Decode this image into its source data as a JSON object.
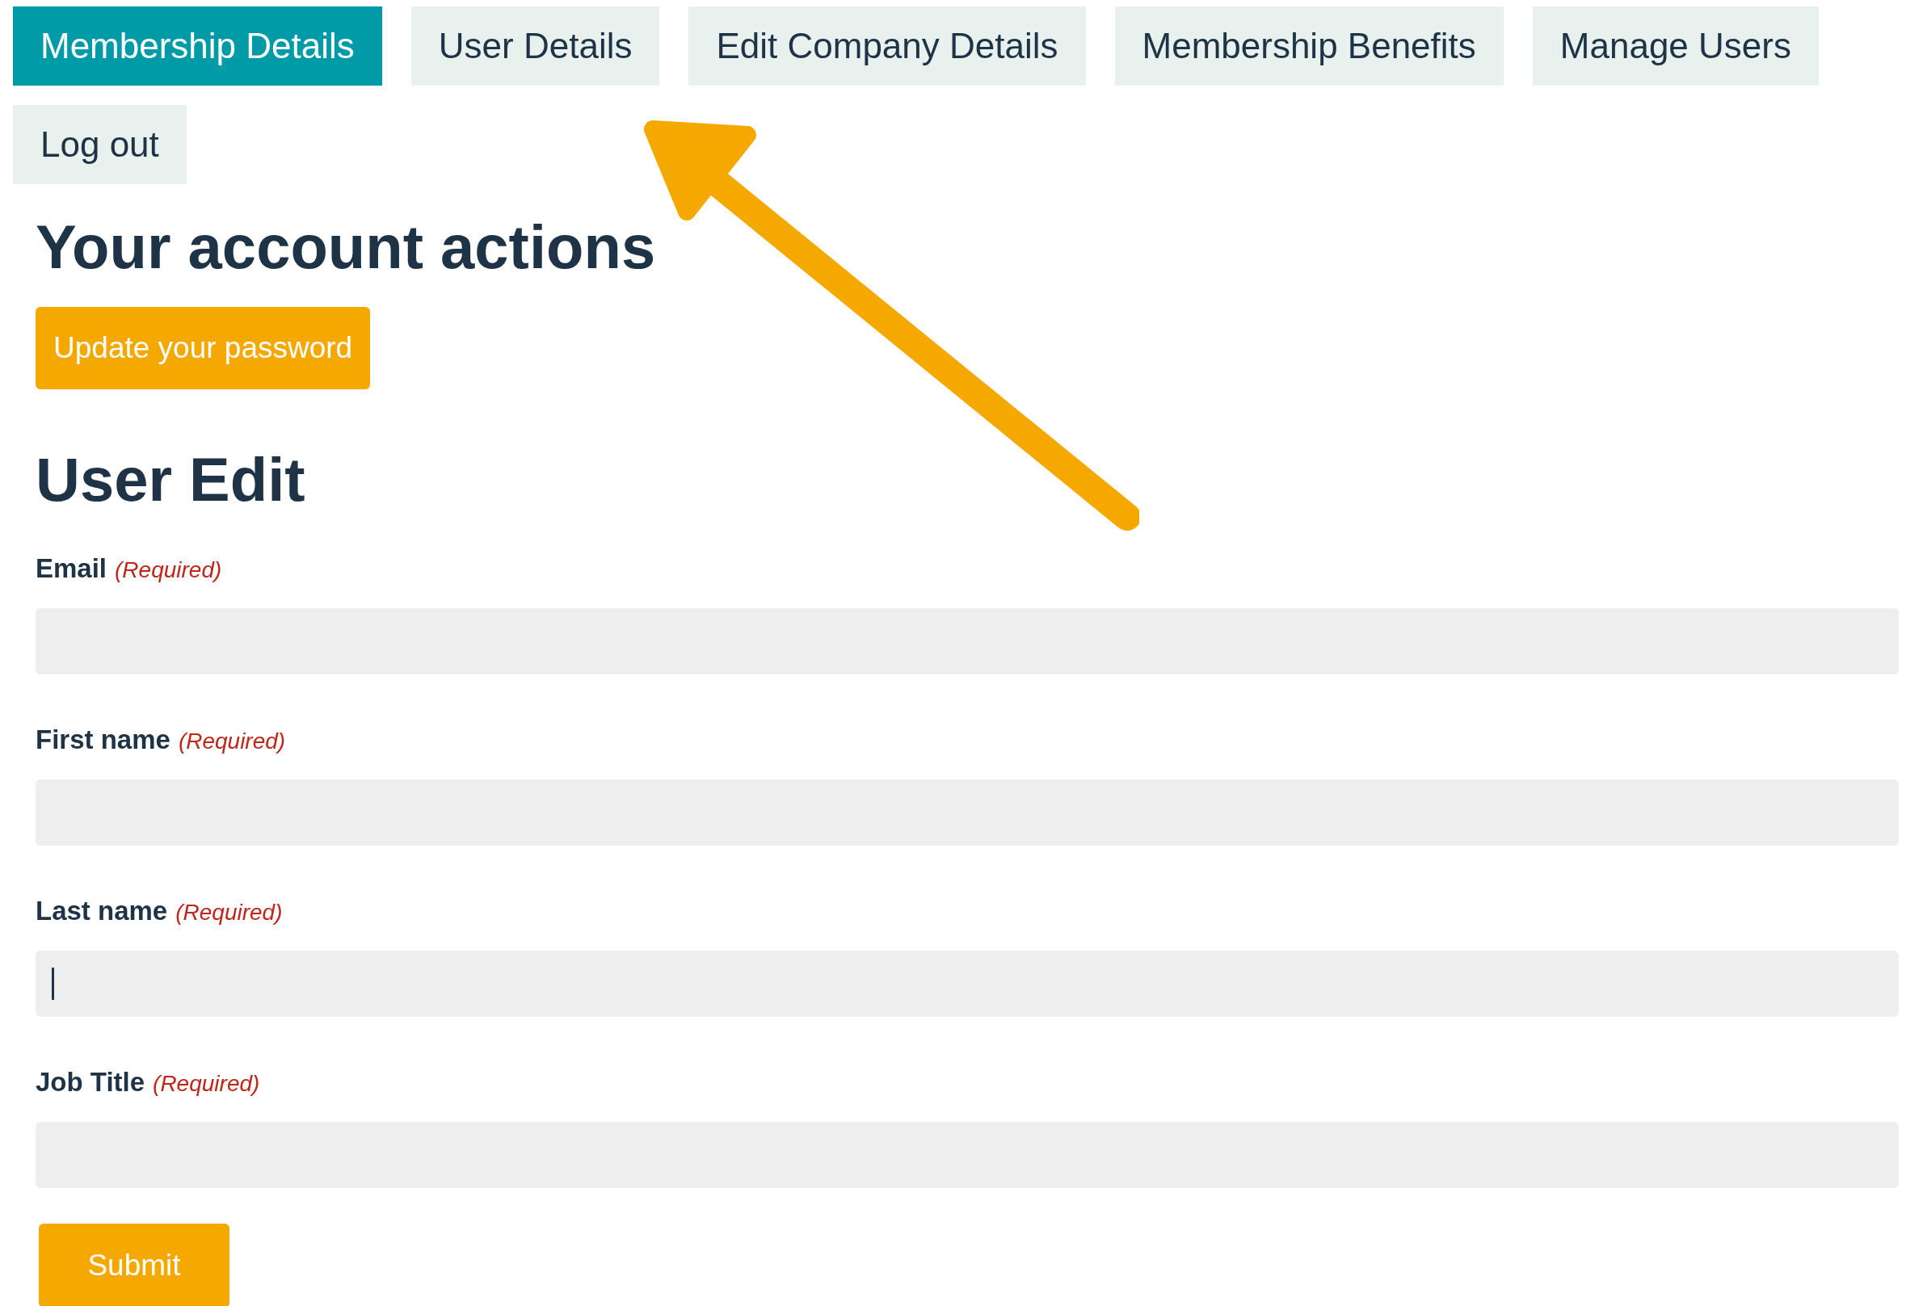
{
  "tabs": [
    {
      "label": "Membership Details",
      "selected": true
    },
    {
      "label": "User Details",
      "selected": false
    },
    {
      "label": "Edit Company Details",
      "selected": false
    },
    {
      "label": "Membership Benefits",
      "selected": false
    },
    {
      "label": "Manage Users",
      "selected": false
    },
    {
      "label": "Log out",
      "selected": false
    }
  ],
  "account_actions": {
    "heading": "Your account actions",
    "button": "Update your password"
  },
  "form": {
    "heading": "User Edit",
    "fields": [
      {
        "label": "Email",
        "required_note": "(Required)",
        "focused": false
      },
      {
        "label": "First name",
        "required_note": "(Required)",
        "focused": false
      },
      {
        "label": "Last name",
        "required_note": "(Required)",
        "focused": true
      },
      {
        "label": "Job Title",
        "required_note": "(Required)",
        "focused": false
      }
    ],
    "submit": "Submit"
  }
}
